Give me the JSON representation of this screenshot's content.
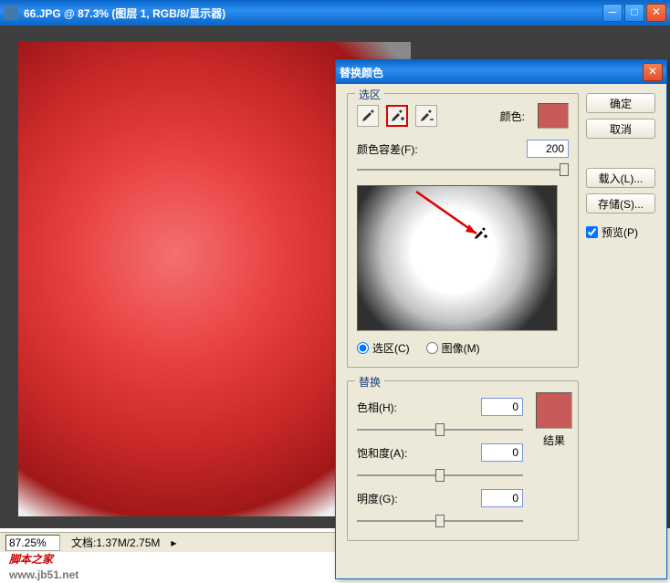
{
  "main_window": {
    "title": "66.JPG @ 87.3% (图层 1, RGB/8/显示器)",
    "zoom": "87.25%",
    "doc_info": "文档:1.37M/2.75M"
  },
  "dialog": {
    "title": "替换颜色",
    "selection_group": "选区",
    "color_label": "颜色:",
    "fuzziness_label": "颜色容差(F):",
    "fuzziness_value": "200",
    "radio_selection": "选区(C)",
    "radio_image": "图像(M)",
    "replace_group": "替换",
    "hue_label": "色相(H):",
    "hue_value": "0",
    "saturation_label": "饱和度(A):",
    "saturation_value": "0",
    "lightness_label": "明度(G):",
    "lightness_value": "0",
    "result_label": "结果",
    "ok": "确定",
    "cancel": "取消",
    "load": "载入(L)...",
    "save": "存储(S)...",
    "preview": "预览(P)",
    "swatch_color": "#c85a5a",
    "result_color": "#c85a5a"
  },
  "watermark": {
    "site_name": "脚本之家",
    "site_url": "www.jb51.net"
  }
}
